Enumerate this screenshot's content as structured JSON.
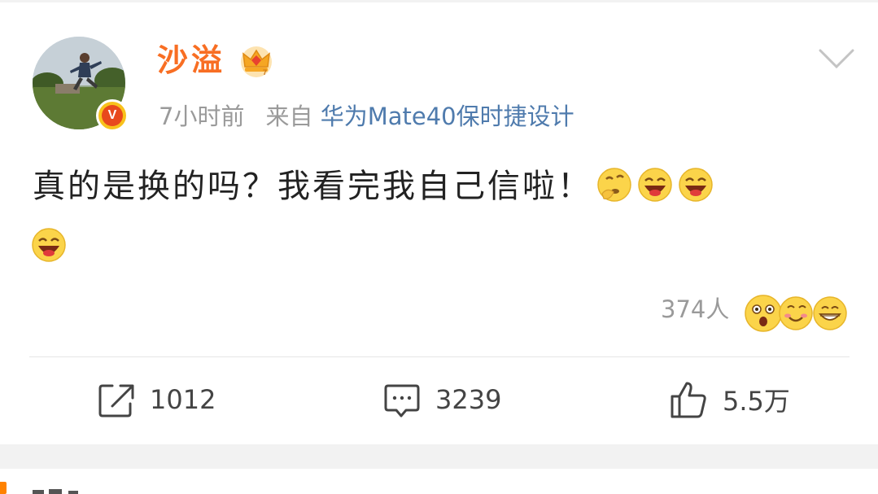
{
  "post": {
    "username": "沙溢",
    "time": "7小时前",
    "from_label": "来自",
    "source": "华为Mate40保时捷设计",
    "text": "真的是换的吗？我看完我自己信啦！",
    "inline_emojis": [
      "thinking-emoji",
      "laughing-emoji",
      "laughing-emoji",
      "laughing-emoji"
    ],
    "reaction_count": "374人",
    "reaction_icons": [
      "surprised-emoji",
      "love-emoji",
      "grinning-emoji"
    ]
  },
  "actions": {
    "repost_count": "1012",
    "comment_count": "3239",
    "like_count": "5.5万"
  },
  "colors": {
    "username": "#f86e23",
    "source_link": "#4f7bad",
    "meta_gray": "#9a9a9a",
    "verified_badge": "#f8c21c",
    "accent_orange": "#ff8200"
  }
}
